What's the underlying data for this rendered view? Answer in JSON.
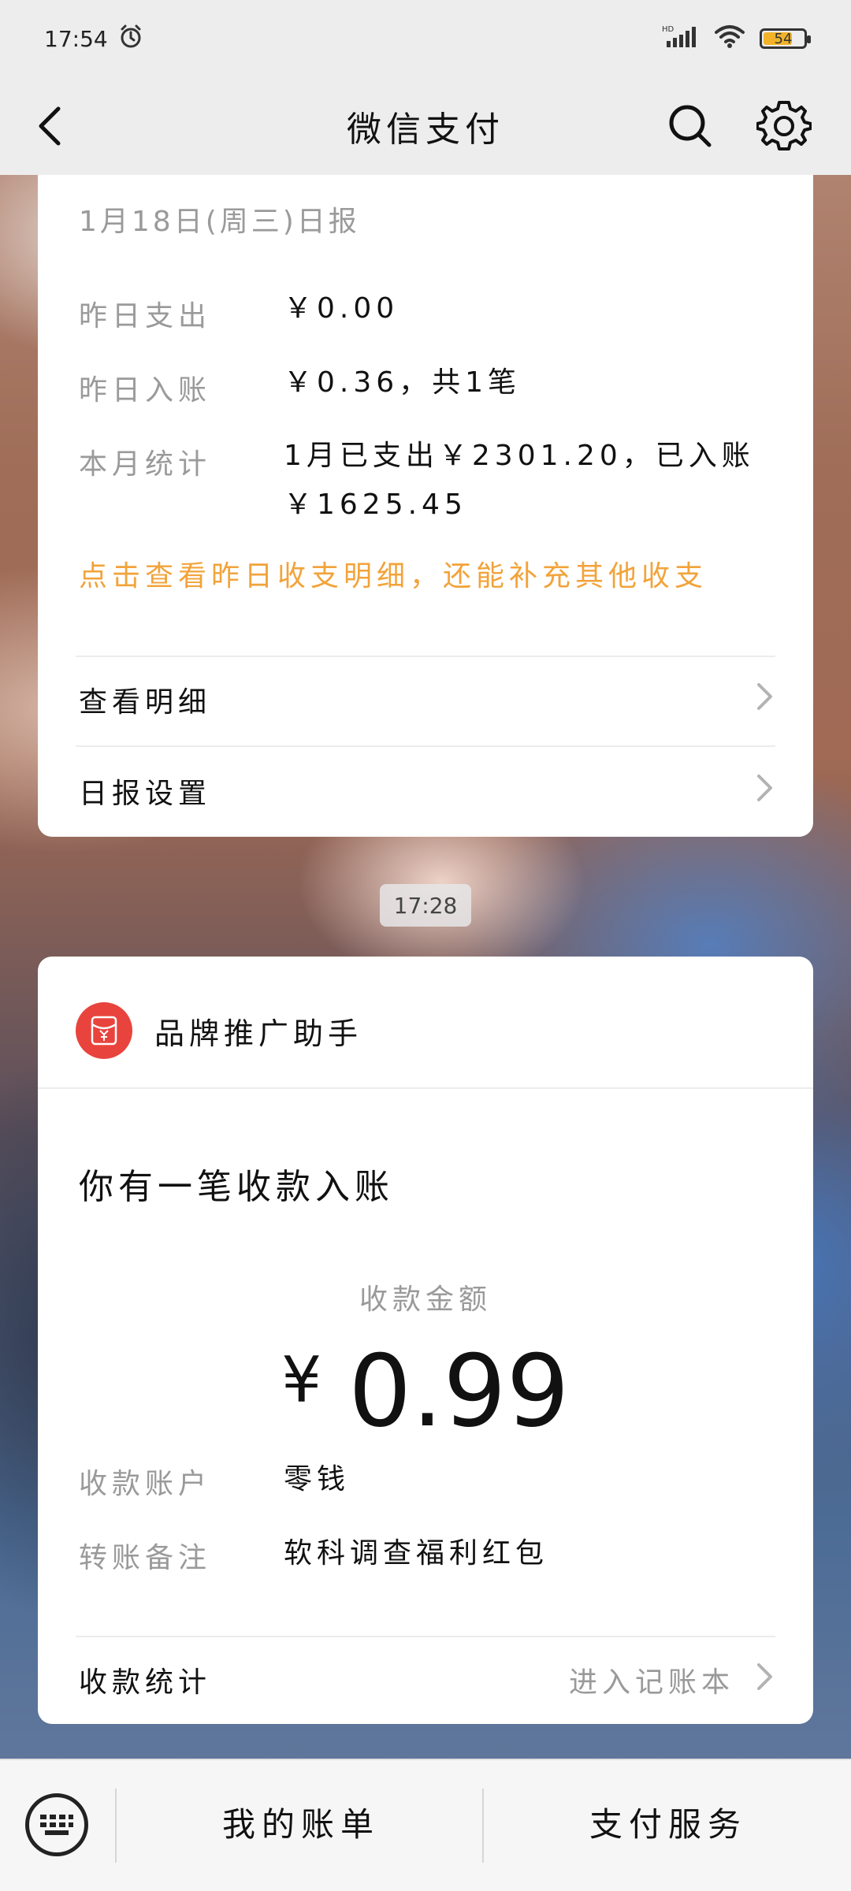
{
  "status_bar": {
    "time": "17:54",
    "network": "HD",
    "battery": "54",
    "icons": [
      "alarm-icon",
      "signal-icon",
      "wifi-icon",
      "battery-icon"
    ]
  },
  "header": {
    "title": "微信支付",
    "icons": [
      "back-icon",
      "search-icon",
      "gear-icon"
    ]
  },
  "daily_report": {
    "title": "1月18日(周三)日报",
    "rows": [
      {
        "label": "昨日支出",
        "value": "￥0.00"
      },
      {
        "label": "昨日入账",
        "value": "￥0.36，共1笔"
      },
      {
        "label": "本月统计",
        "value": "1月已支出￥2301.20，已入账￥1625.45"
      }
    ],
    "hint": "点击查看昨日收支明细，还能补充其他收支",
    "links": [
      {
        "label": "查看明细"
      },
      {
        "label": "日报设置"
      }
    ]
  },
  "time_divider": "17:28",
  "receipt": {
    "brand_name": "品牌推广助手",
    "brand_icon": "red-envelope-icon",
    "headline": "你有一笔收款入账",
    "amount_label": "收款金额",
    "currency": "¥",
    "amount": "0.99",
    "rows": [
      {
        "label": "收款账户",
        "value": "零钱"
      },
      {
        "label": "转账备注",
        "value": "软科调查福利红包"
      }
    ],
    "stats_label": "收款统计",
    "stats_link": "进入记账本"
  },
  "bottom_bar": {
    "tabs": [
      "我的账单",
      "支付服务"
    ],
    "left_icon": "keyboard-icon"
  },
  "colors": {
    "accent": "#f2a33a",
    "brand_red": "#e9433d",
    "muted": "#9a9a9a"
  }
}
